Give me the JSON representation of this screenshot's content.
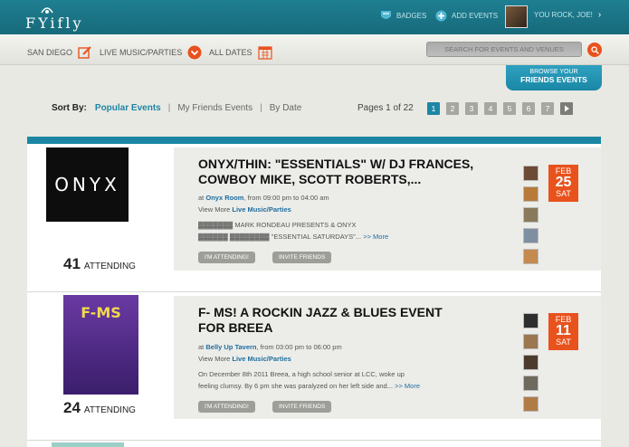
{
  "header": {
    "logo": "FYifly",
    "badges_label": "BADGES",
    "add_events_label": "ADD EVENTS",
    "user_label": "YOU ROCK, JOE!"
  },
  "filters": {
    "location": "SAN DIEGO",
    "category": "LIVE MUSIC/PARTIES",
    "dates": "ALL DATES",
    "search_placeholder": "SEARCH FOR EVENTS AND VENUES"
  },
  "friends_tab": {
    "line1": "BROWSE YOUR",
    "line2": "FRIENDS EVENTS"
  },
  "sort": {
    "label": "Sort By:",
    "options": [
      "Popular Events",
      "My Friends Events",
      "By Date"
    ],
    "active": "Popular Events"
  },
  "pagination": {
    "text": "Pages 1 of 22",
    "pages": [
      "1",
      "2",
      "3",
      "4",
      "5",
      "6",
      "7"
    ],
    "current": "1"
  },
  "events": [
    {
      "title": "ONYX/THIN: \"ESSENTIALS\" W/ DJ FRANCES, COWBOY MIKE, SCOTT ROBERTS,...",
      "thumb_text": "ONYX",
      "attending_count": "41",
      "attending_label": "ATTENDING",
      "at": "at",
      "venue": "Onyx Room",
      "time": ", from 09:00 pm to 04:00 am",
      "view_more": "View More",
      "category_link": "Live Music/Parties",
      "desc_line1": "▓▓▓▓▓▓▓ MARK RONDEAU PRESENTS & ONYX",
      "desc_line2": "▓▓▓▓▓▓ ▓▓▓▓▓▓▓▓ \"ESSENTIAL SATURDAYS\"...",
      "more": ">> More",
      "attend_btn": "I'M ATTENDING!",
      "invite_btn": "INVITE FRIENDS",
      "month": "FEB",
      "day": "25",
      "weekday": "SAT"
    },
    {
      "title": "F- MS! A ROCKIN JAZZ & BLUES EVENT FOR BREEA",
      "thumb_text": "F-MS",
      "attending_count": "24",
      "attending_label": "ATTENDING",
      "at": "at",
      "venue": "Belly Up Tavern",
      "time": ", from 03:00 pm to 06:00 pm",
      "view_more": "View More",
      "category_link": "Live Music/Parties",
      "desc_line1": "On December 8th 2011 Breea, a high school senior at LCC, woke up",
      "desc_line2": "feeling clumsy. By 6 pm she was paralyzed on her left side and...",
      "more": ">> More",
      "attend_btn": "I'M ATTENDING!",
      "invite_btn": "INVITE FRIENDS",
      "month": "FEB",
      "day": "11",
      "weekday": "SAT"
    }
  ],
  "colors": {
    "teal": "#1e86a5",
    "orange": "#e8521d"
  }
}
